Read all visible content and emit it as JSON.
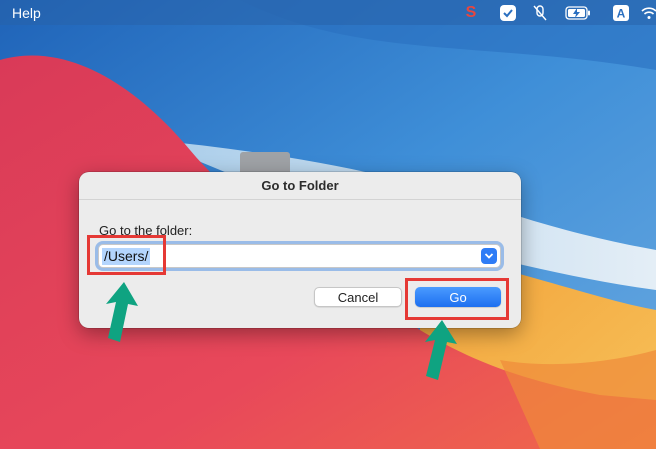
{
  "menubar": {
    "help_label": "Help",
    "status_s": "S",
    "status_a": "A",
    "icons": [
      "s-app-icon",
      "checkmark-app-icon",
      "mute-icon",
      "battery-charging-icon",
      "input-source-icon",
      "wifi-icon"
    ]
  },
  "dialog": {
    "title": "Go to Folder",
    "folder_label": "Go to the folder:",
    "path_value": "/Users/",
    "cancel_label": "Cancel",
    "go_label": "Go"
  },
  "annotations": {
    "highlight_color": "#e53935",
    "arrow_color": "#0fa381"
  },
  "colors": {
    "accent": "#1d6ff0",
    "selection": "#b4d5fd"
  }
}
